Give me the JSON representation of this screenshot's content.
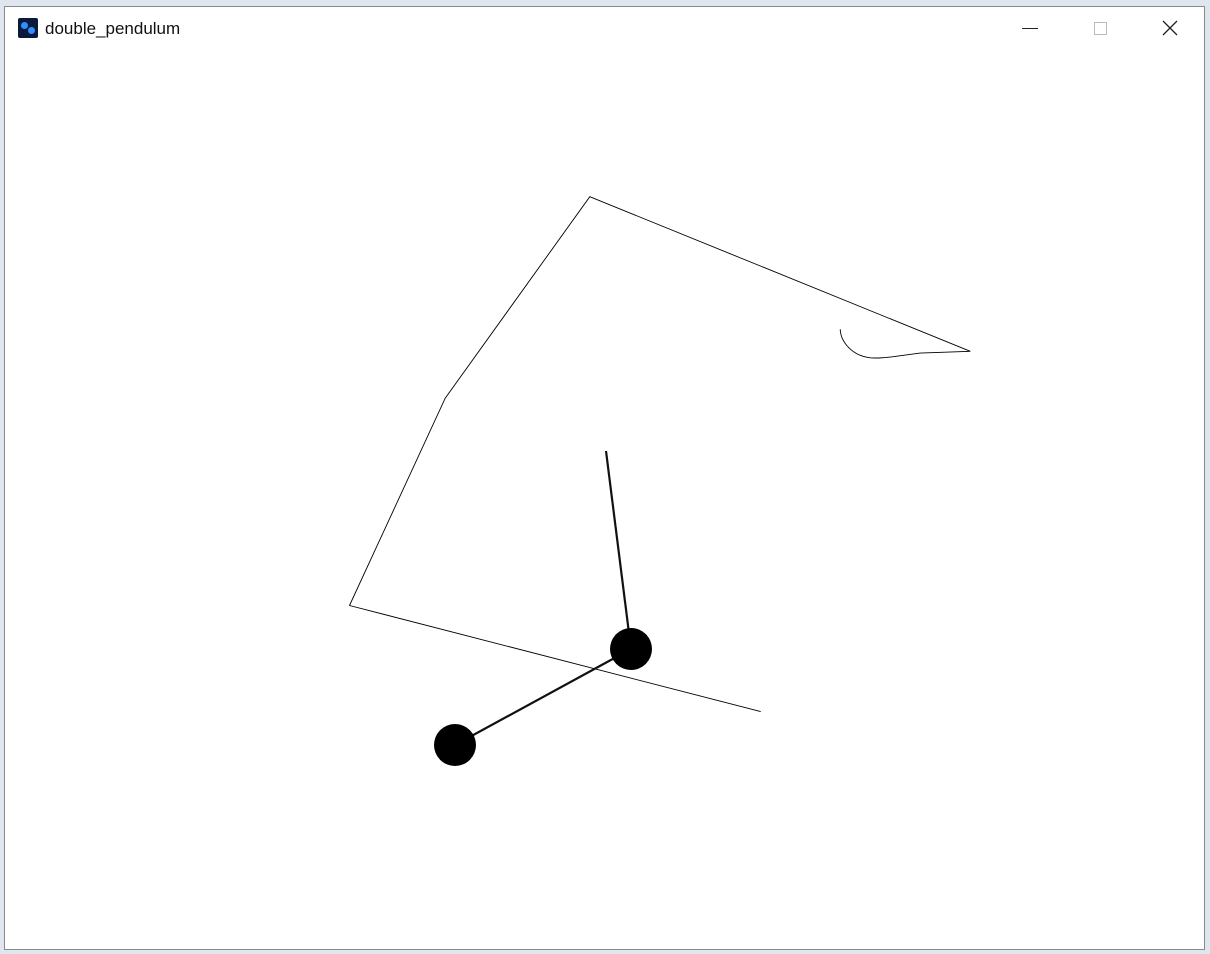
{
  "window": {
    "title": "double_pendulum",
    "icon": "processing-app-icon",
    "controls": {
      "minimize": "minimize-icon",
      "maximize": "maximize-icon",
      "close": "close-icon"
    }
  },
  "colors": {
    "background": "#ffffff",
    "trace": "#000000",
    "bob": "#000000",
    "rod": "#111111"
  }
}
